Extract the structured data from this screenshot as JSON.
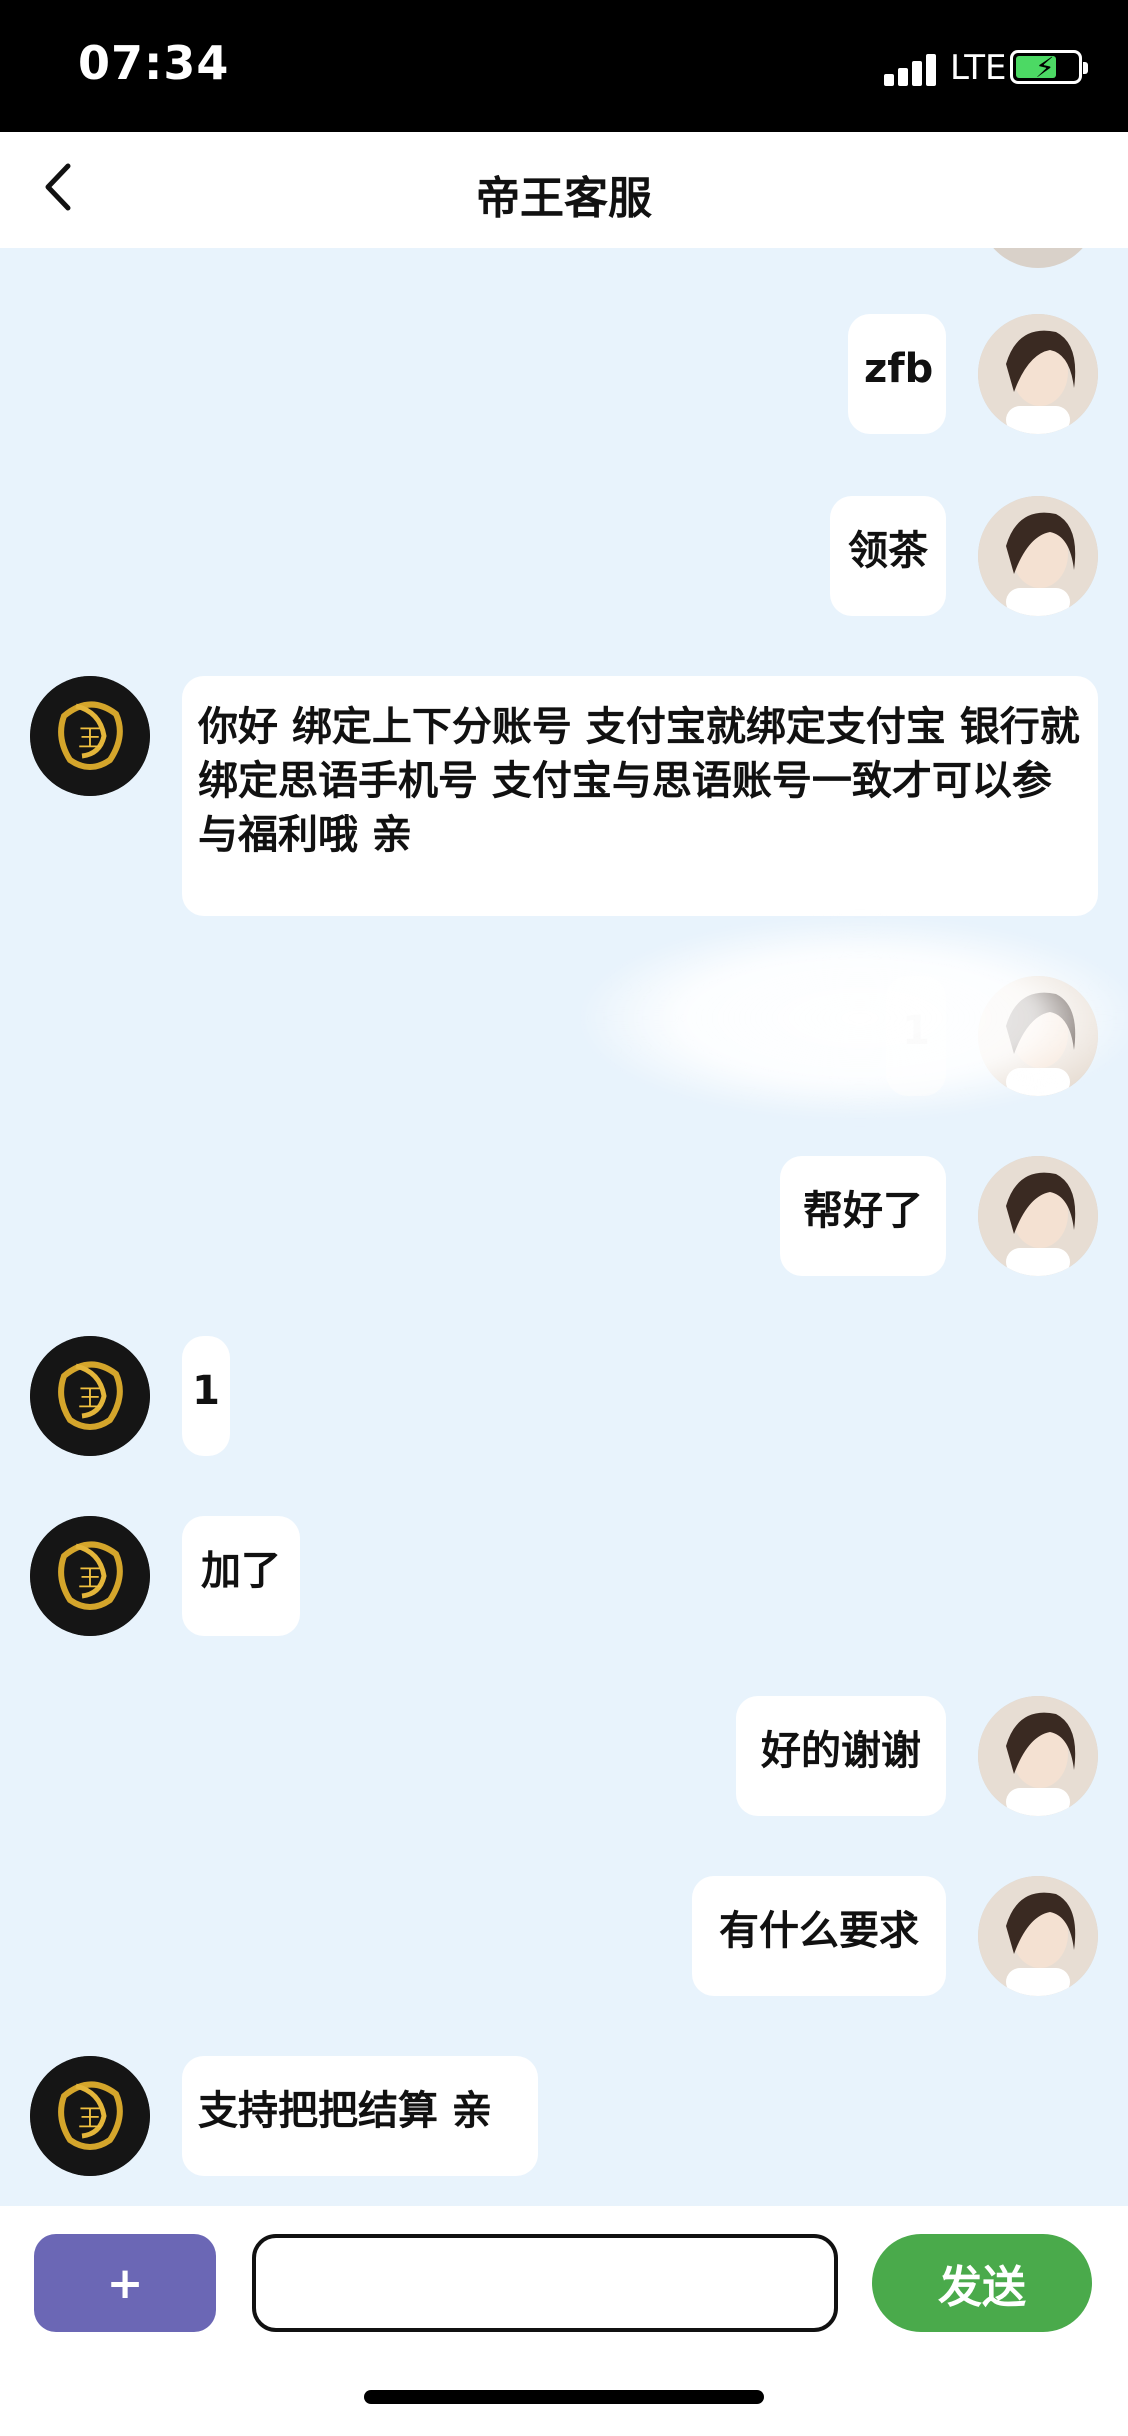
{
  "status_bar": {
    "time": "07:34",
    "network": "LTE",
    "icons": [
      "signal-icon",
      "battery-charging-icon"
    ]
  },
  "nav": {
    "title": "帝王客服",
    "back_icon": "chevron-left-icon"
  },
  "messages": [
    {
      "sender": "me",
      "text": "zfb"
    },
    {
      "sender": "me",
      "text": "领茶"
    },
    {
      "sender": "cs",
      "text": "你好 绑定上下分账号 支付宝就绑定支付宝 银行就绑定思语手机号 支付宝与思语账号一致才可以参与福利哦 亲"
    },
    {
      "sender": "me",
      "text": "1"
    },
    {
      "sender": "me",
      "text": "帮好了"
    },
    {
      "sender": "cs",
      "text": "1"
    },
    {
      "sender": "cs",
      "text": "加了"
    },
    {
      "sender": "me",
      "text": "好的谢谢"
    },
    {
      "sender": "me",
      "text": "有什么要求"
    },
    {
      "sender": "cs",
      "text": "支持把把结算 亲"
    }
  ],
  "input_bar": {
    "plus_label": "+",
    "input_value": "",
    "send_label": "发送"
  },
  "colors": {
    "chat_background": "#e8f3fc",
    "plus_button": "#6b67b5",
    "send_button": "#4aaa4b"
  }
}
